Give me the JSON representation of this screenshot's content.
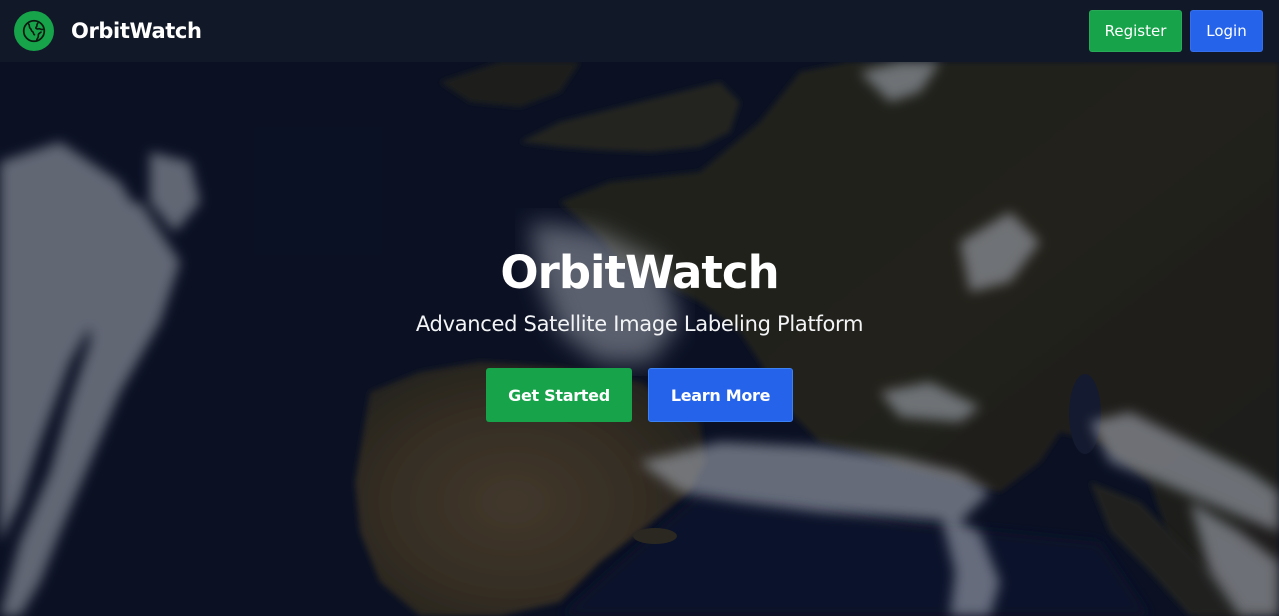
{
  "navbar": {
    "brand": "OrbitWatch",
    "logo_icon": "globe-icon",
    "register_label": "Register",
    "login_label": "Login"
  },
  "hero": {
    "title": "OrbitWatch",
    "subtitle": "Advanced Satellite Image Labeling Platform",
    "get_started_label": "Get Started",
    "learn_more_label": "Learn More",
    "background": "satellite-view-western-europe"
  },
  "colors": {
    "navbar_bg": "#111827",
    "green": "#16a34a",
    "blue": "#2563eb",
    "text": "#ffffff"
  }
}
